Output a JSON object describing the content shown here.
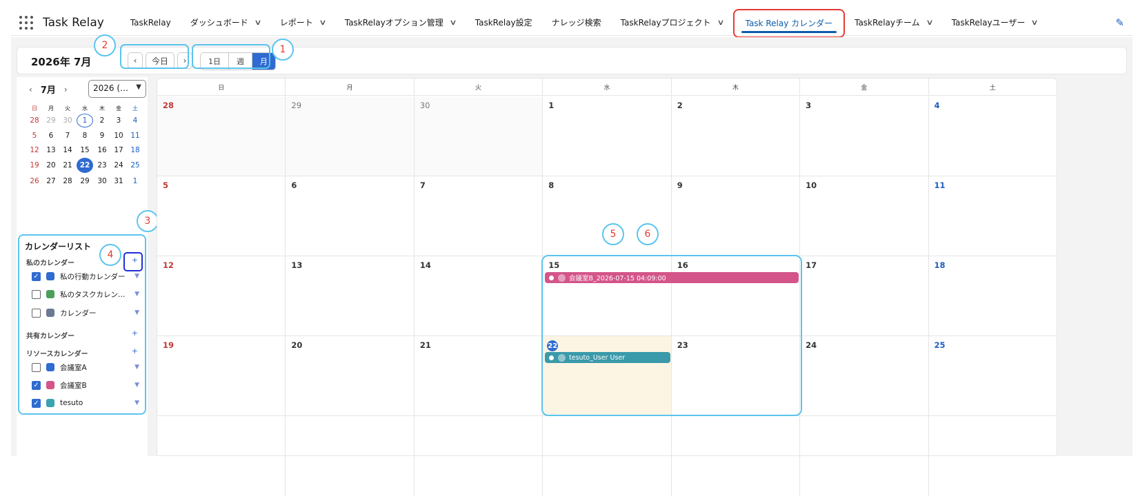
{
  "app": {
    "name": "Task Relay"
  },
  "nav": {
    "items": [
      {
        "label": "TaskRelay",
        "dropdown": false
      },
      {
        "label": "ダッシュボード",
        "dropdown": true
      },
      {
        "label": "レポート",
        "dropdown": true
      },
      {
        "label": "TaskRelayオプション管理",
        "dropdown": true
      },
      {
        "label": "TaskRelay設定",
        "dropdown": false
      },
      {
        "label": "ナレッジ検索",
        "dropdown": false
      },
      {
        "label": "TaskRelayプロジェクト",
        "dropdown": true
      },
      {
        "label": "Task Relay カレンダー",
        "dropdown": false,
        "active": true
      },
      {
        "label": "TaskRelayチーム",
        "dropdown": true
      },
      {
        "label": "TaskRelayユーザー",
        "dropdown": true
      }
    ]
  },
  "toolbar": {
    "title": "2026年 7月",
    "prev": "‹",
    "today": "今日",
    "next": "›",
    "views": [
      "1日",
      "週",
      "月"
    ],
    "selected_view": "月"
  },
  "callouts": {
    "c1": "1",
    "c2": "2",
    "c3": "3",
    "c4": "4",
    "c5": "5",
    "c6": "6"
  },
  "mini_calendar": {
    "prev": "‹",
    "month": "7月",
    "next": "›",
    "year_select": "2026 (…",
    "weekdays": [
      "日",
      "月",
      "火",
      "水",
      "木",
      "金",
      "土"
    ],
    "weeks": [
      [
        "28",
        "29",
        "30",
        "1",
        "2",
        "3",
        "4"
      ],
      [
        "5",
        "6",
        "7",
        "8",
        "9",
        "10",
        "11"
      ],
      [
        "12",
        "13",
        "14",
        "15",
        "16",
        "17",
        "18"
      ],
      [
        "19",
        "20",
        "21",
        "22",
        "23",
        "24",
        "25"
      ],
      [
        "26",
        "27",
        "28",
        "29",
        "30",
        "31",
        "1"
      ]
    ]
  },
  "calendar_list": {
    "title": "カレンダーリスト",
    "plus": "+",
    "sections": [
      {
        "label": "私のカレンダー",
        "items": [
          {
            "label": "私の行動カレンダー",
            "checked": true,
            "color": "#2f6bd0"
          },
          {
            "label": "私のタスクカレンダー",
            "checked": false,
            "color": "#4aa05a"
          },
          {
            "label": "カレンダー",
            "checked": false,
            "color": "#6b7a93"
          }
        ]
      },
      {
        "label": "共有カレンダー",
        "items": []
      },
      {
        "label": "リソースカレンダー",
        "items": [
          {
            "label": "会議室A",
            "checked": false,
            "color": "#2f6bd0"
          },
          {
            "label": "会議室B",
            "checked": true,
            "color": "#d3558a"
          },
          {
            "label": "tesuto",
            "checked": true,
            "color": "#3aa3b0"
          }
        ]
      }
    ]
  },
  "month_grid": {
    "weekdays": [
      "日",
      "月",
      "火",
      "水",
      "木",
      "金",
      "土"
    ],
    "weeks": [
      [
        "28",
        "29",
        "30",
        "1",
        "2",
        "3",
        "4"
      ],
      [
        "5",
        "6",
        "7",
        "8",
        "9",
        "10",
        "11"
      ],
      [
        "12",
        "13",
        "14",
        "15",
        "16",
        "17",
        "18"
      ],
      [
        "19",
        "20",
        "21",
        "22",
        "23",
        "24",
        "25"
      ]
    ],
    "events": [
      {
        "label": "会議室B_2026-07-15 04:09:00",
        "color": "#d3558a"
      },
      {
        "label": "tesuto_User User",
        "color": "#3a9aaa"
      }
    ]
  },
  "colors": {
    "accent": "#2f6bd0",
    "highlight": "#5bc4ee",
    "callout_text": "#e53935"
  }
}
